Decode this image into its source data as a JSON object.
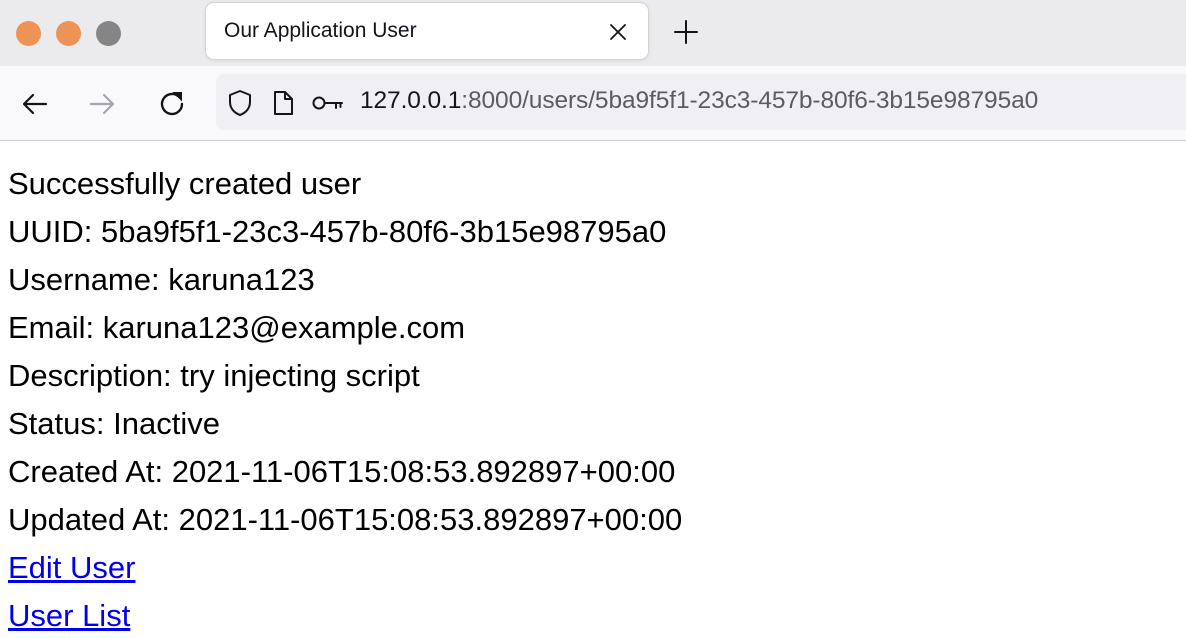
{
  "browser": {
    "tab": {
      "title": "Our Application User"
    },
    "url": {
      "host": "127.0.0.1",
      "rest": ":8000/users/5ba9f5f1-23c3-457b-80f6-3b15e98795a0"
    },
    "traffic_light_colors": [
      "#ed9356",
      "#ed9356",
      "#858585"
    ]
  },
  "page": {
    "message": "Successfully created user",
    "uuid": "UUID: 5ba9f5f1-23c3-457b-80f6-3b15e98795a0",
    "username": "Username: karuna123",
    "email": "Email: karuna123@example.com",
    "description": "Description: try injecting script",
    "status": "Status: Inactive",
    "created_at": "Created At: 2021-11-06T15:08:53.892897+00:00",
    "updated_at": "Updated At: 2021-11-06T15:08:53.892897+00:00",
    "links": {
      "edit_user": "Edit User",
      "user_list": "User List"
    },
    "link_color": "#0000ee"
  }
}
